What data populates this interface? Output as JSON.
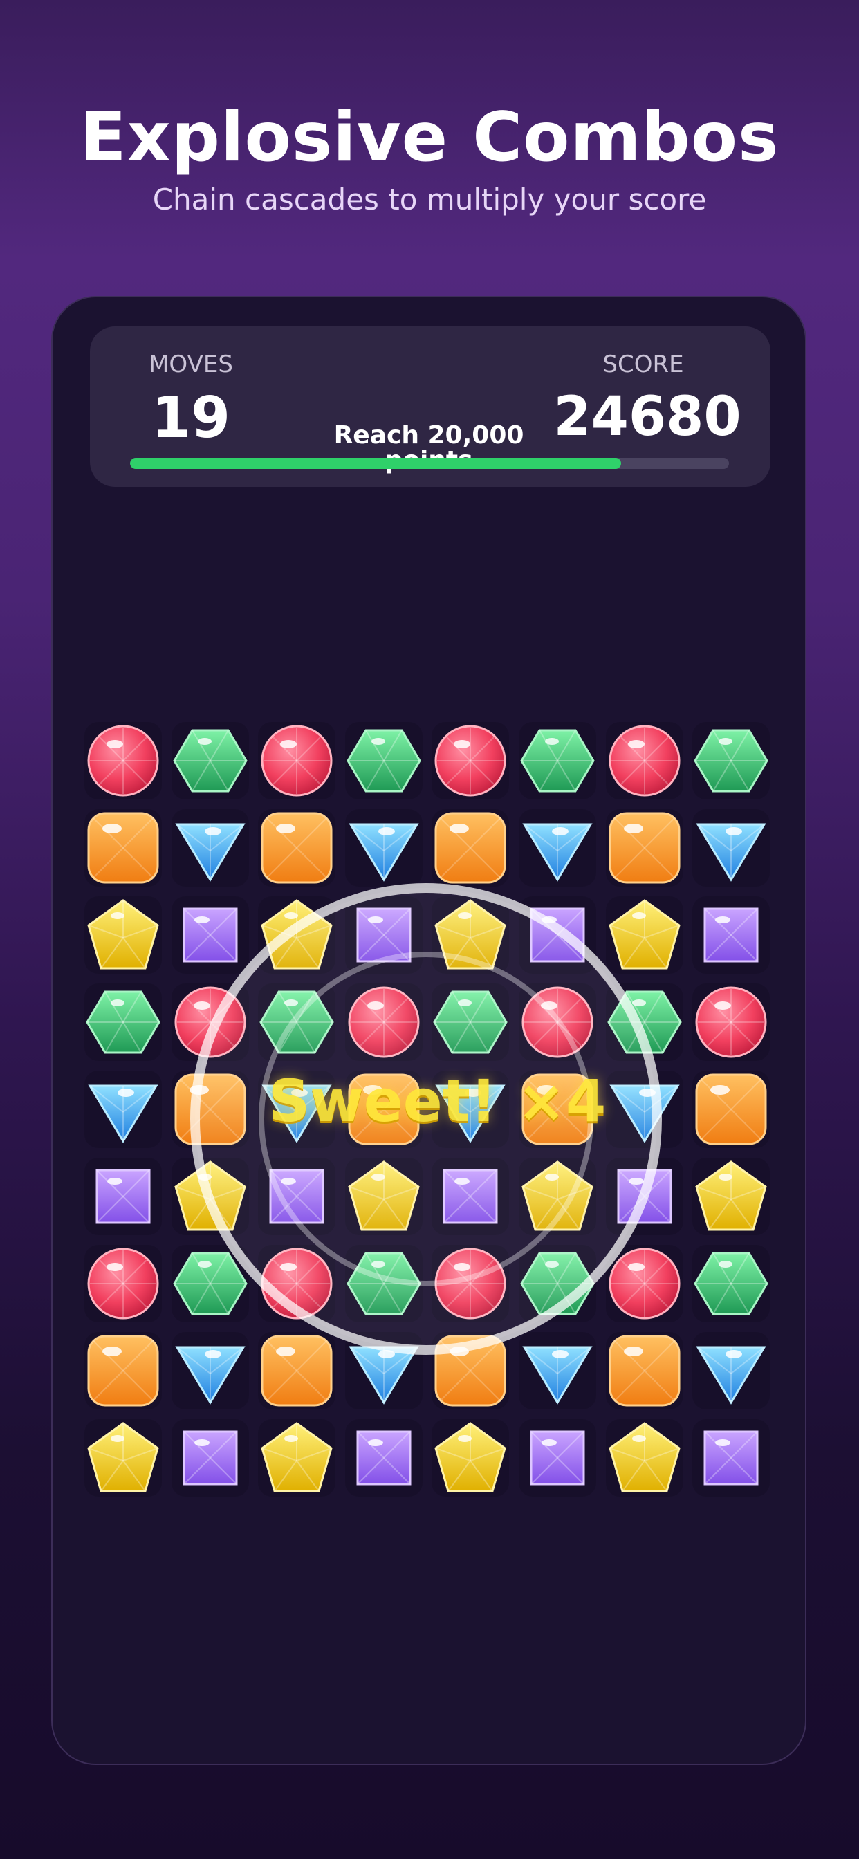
{
  "hero": {
    "title": "Explosive Combos",
    "subtitle": "Chain cascades to multiply your score"
  },
  "hud": {
    "moves_label": "MOVES",
    "moves_value": "19",
    "score_label": "SCORE",
    "score_value": "24680",
    "goal_text": "Reach 20,000 points",
    "progress_fraction": 0.82
  },
  "combo": {
    "text": "Sweet!  ×4"
  },
  "colors": {
    "accent_green": "#2fd16a",
    "combo_yellow": "#ffe83a"
  },
  "gem_types": {
    "R": "red-circle-gem",
    "G": "green-hexagon-gem",
    "O": "orange-square-gem",
    "B": "blue-triangle-gem",
    "Y": "yellow-pentagon-gem",
    "P": "purple-square-gem"
  },
  "board": {
    "rows": [
      [
        "R",
        "G",
        "R",
        "G",
        "R",
        "G",
        "R",
        "G"
      ],
      [
        "O",
        "B",
        "O",
        "B",
        "O",
        "B",
        "O",
        "B"
      ],
      [
        "Y",
        "P",
        "Y",
        "P",
        "Y",
        "P",
        "Y",
        "P"
      ],
      [
        "G",
        "R",
        "G",
        "R",
        "G",
        "R",
        "G",
        "R"
      ],
      [
        "B",
        "O",
        "B",
        "O",
        "B",
        "O",
        "B",
        "O"
      ],
      [
        "P",
        "Y",
        "P",
        "Y",
        "P",
        "Y",
        "P",
        "Y"
      ],
      [
        "R",
        "G",
        "R",
        "G",
        "R",
        "G",
        "R",
        "G"
      ],
      [
        "O",
        "B",
        "O",
        "B",
        "O",
        "B",
        "O",
        "B"
      ],
      [
        "Y",
        "P",
        "Y",
        "P",
        "Y",
        "P",
        "Y",
        "P"
      ]
    ]
  }
}
